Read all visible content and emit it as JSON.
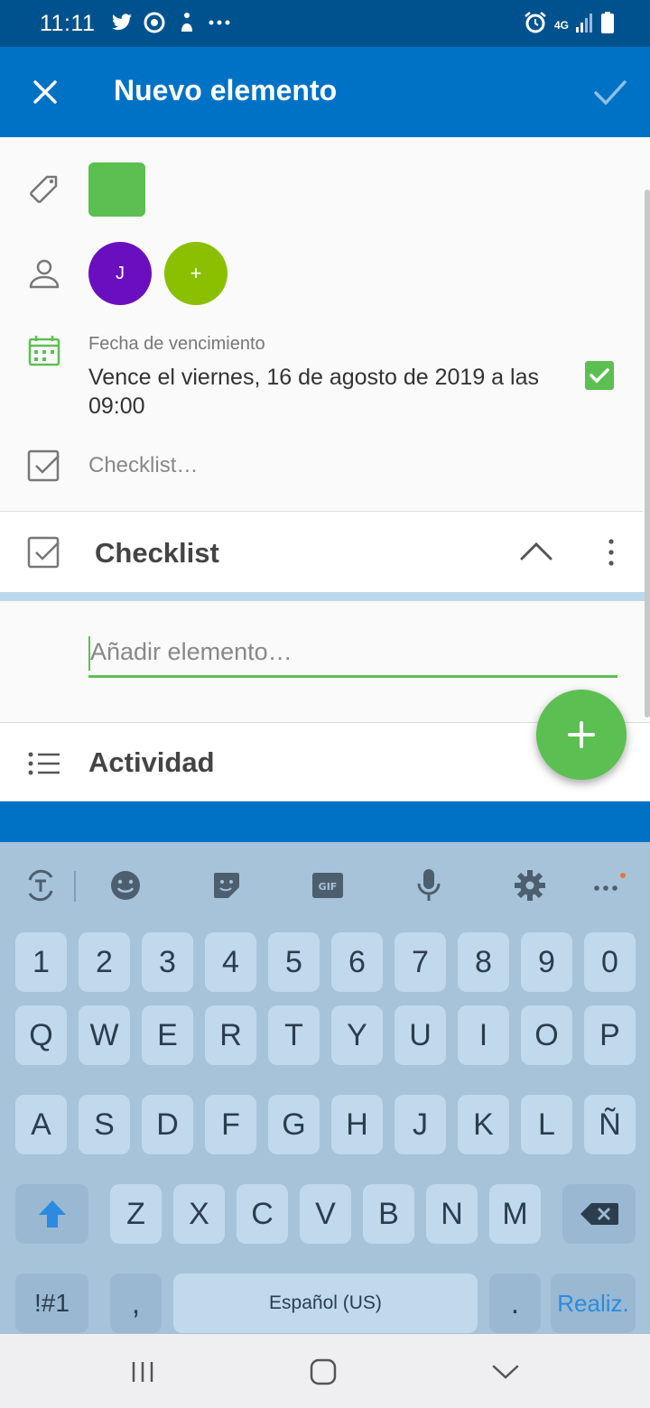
{
  "status": {
    "time": "11:11",
    "network": "4G"
  },
  "appbar": {
    "title": "Nuevo elemento"
  },
  "item": {
    "due_label": "Fecha de vencimiento",
    "due_value": "Vence el viernes, 16 de agosto de 2019 a las 09:00",
    "checklist_placeholder": "Checklist…",
    "color": "#5cbf51",
    "assignees": [
      {
        "initial": "J",
        "color": "#6a0fc0"
      },
      {
        "initial": "+",
        "color": "#8bc000"
      }
    ]
  },
  "checklist": {
    "title": "Checklist",
    "input_placeholder": "Añadir elemento…"
  },
  "activity": {
    "title": "Actividad"
  },
  "keyboard": {
    "row_numbers": [
      "1",
      "2",
      "3",
      "4",
      "5",
      "6",
      "7",
      "8",
      "9",
      "0"
    ],
    "row_q": [
      "Q",
      "W",
      "E",
      "R",
      "T",
      "Y",
      "U",
      "I",
      "O",
      "P"
    ],
    "row_a": [
      "A",
      "S",
      "D",
      "F",
      "G",
      "H",
      "J",
      "K",
      "L",
      "Ñ"
    ],
    "row_z": [
      "Z",
      "X",
      "C",
      "V",
      "B",
      "N",
      "M"
    ],
    "symbols_key": "!#1",
    "comma_key": ",",
    "space_label": "Español (US)",
    "period_key": ".",
    "done_key": "Realiz."
  },
  "colors": {
    "primary": "#0072c6",
    "status_bar": "#00528f",
    "accent_green": "#5cbf51",
    "keyboard_bg": "#a6c3da"
  }
}
